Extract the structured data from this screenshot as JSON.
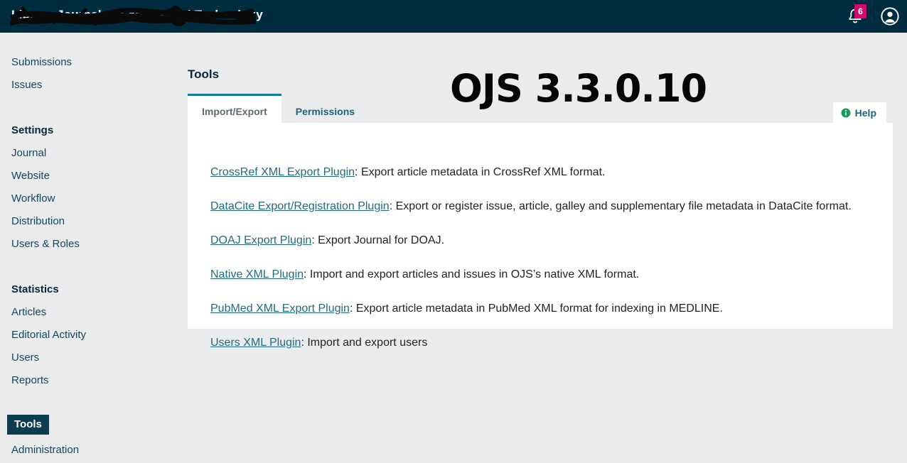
{
  "header": {
    "site_title": "Library Journal of Service And Technology",
    "site_title_redacted": true,
    "notifications": {
      "icon": "bell-icon",
      "count": "6",
      "badge_color": "#d00a6c"
    },
    "account": {
      "icon": "user-avatar-icon"
    },
    "background_color": "#002c40"
  },
  "sidebar": {
    "items": [
      {
        "label": "Submissions",
        "type": "link",
        "active": false
      },
      {
        "label": "Issues",
        "type": "link",
        "active": false
      },
      {
        "label": "Settings",
        "type": "heading",
        "active": false
      },
      {
        "label": "Journal",
        "type": "link",
        "active": false
      },
      {
        "label": "Website",
        "type": "link",
        "active": false
      },
      {
        "label": "Workflow",
        "type": "link",
        "active": false
      },
      {
        "label": "Distribution",
        "type": "link",
        "active": false
      },
      {
        "label": "Users & Roles",
        "type": "link",
        "active": false
      },
      {
        "label": "Statistics",
        "type": "heading",
        "active": false
      },
      {
        "label": "Articles",
        "type": "link",
        "active": false
      },
      {
        "label": "Editorial Activity",
        "type": "link",
        "active": false
      },
      {
        "label": "Users",
        "type": "link",
        "active": false
      },
      {
        "label": "Reports",
        "type": "link",
        "active": false
      },
      {
        "label": "Tools",
        "type": "link",
        "active": true
      },
      {
        "label": "Administration",
        "type": "link",
        "active": false
      }
    ],
    "active_color": "#0d3b50"
  },
  "main": {
    "page_title": "Tools",
    "tabs": [
      {
        "label": "Import/Export",
        "active": true
      },
      {
        "label": "Permissions",
        "active": false
      }
    ],
    "help_button": {
      "label": "Help",
      "icon": "info-circle-icon",
      "icon_color": "#1c9b5e"
    },
    "plugins": [
      {
        "name": "CrossRef XML Export Plugin",
        "description": ": Export article metadata in CrossRef XML format."
      },
      {
        "name": "DataCite Export/Registration Plugin",
        "description": ": Export or register issue, article, galley and supplementary file metadata in DataCite format."
      },
      {
        "name": "DOAJ Export Plugin",
        "description": ": Export Journal for DOAJ."
      },
      {
        "name": "Native XML Plugin",
        "description": ": Import and export articles and issues in OJS’s native XML format."
      },
      {
        "name": "PubMed XML Export Plugin",
        "description": ": Export article metadata in PubMed XML format for indexing in MEDLINE."
      },
      {
        "name": "Users XML Plugin",
        "description": ": Import and export users"
      }
    ],
    "link_color": "#246b7e"
  },
  "annotation": {
    "version_overlay": "OJS 3.3.0.10"
  }
}
